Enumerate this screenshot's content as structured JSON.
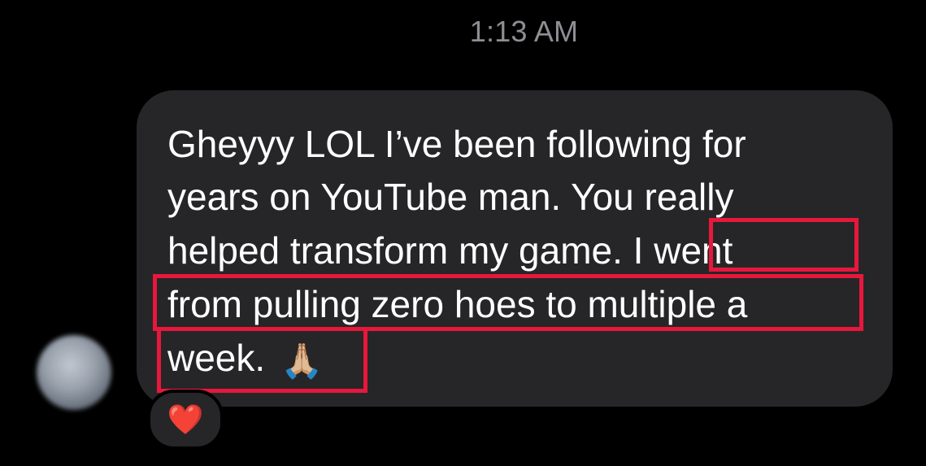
{
  "thread": {
    "timestamp": "1:13 AM"
  },
  "message": {
    "lines": [
      "Gheyyy LOL I’ve been following for",
      "years on YouTube man. You really",
      "helped transform my game. I went",
      "from pulling zero hoes to multiple a",
      "week."
    ],
    "emoji": "🙏🏼"
  },
  "reaction": {
    "emoji": "❤️"
  },
  "colors": {
    "background": "#000000",
    "bubble": "#262628",
    "text": "#ffffff",
    "timestamp": "#8e8e93",
    "highlight": "#e8173c"
  },
  "icons": {
    "avatar": "avatar",
    "reaction": "heart-icon"
  }
}
